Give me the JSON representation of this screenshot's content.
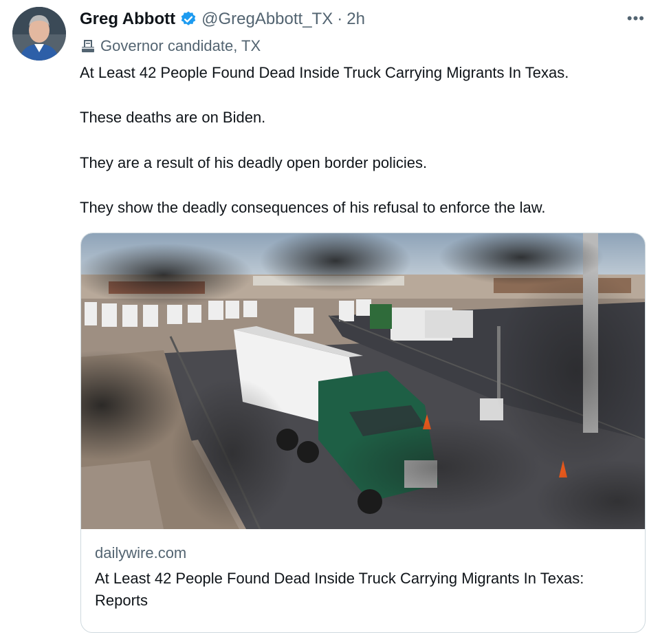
{
  "author": {
    "name": "Greg Abbott",
    "handle": "@GregAbbott_TX",
    "separator": "·",
    "time": "2h",
    "label": "Governor candidate, TX",
    "verified_color": "#1d9bf0"
  },
  "menu": {
    "more_label": "•••"
  },
  "tweet": {
    "paragraphs": [
      "At Least 42 People Found Dead Inside Truck Carrying Migrants In Texas.",
      "These deaths are on Biden.",
      "They are a result of his deadly open border policies.",
      "They show the deadly consequences of his refusal to enforce the law."
    ]
  },
  "card": {
    "domain": "dailywire.com",
    "title": "At Least 42 People Found Dead Inside Truck Carrying Migrants In Texas: Reports",
    "image_description_icon": "photo-truck-border-fence"
  },
  "icons": {
    "verified": "verified-badge-icon",
    "label": "ballot-box-icon",
    "more": "more-options-icon"
  }
}
